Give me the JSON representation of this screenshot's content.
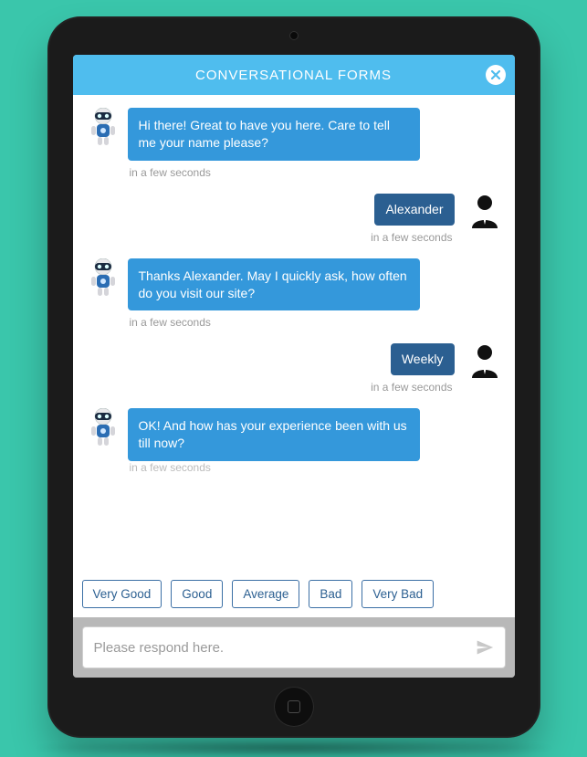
{
  "header": {
    "title": "CONVERSATIONAL FORMS"
  },
  "conversation": [
    {
      "sender": "bot",
      "text": "Hi there! Great to have you here. Care to tell me your name please?",
      "time": "in a few seconds"
    },
    {
      "sender": "user",
      "text": "Alexander",
      "time": "in a few seconds"
    },
    {
      "sender": "bot",
      "text": "Thanks Alexander. May I quickly ask, how often do you visit our site?",
      "time": "in a few seconds"
    },
    {
      "sender": "user",
      "text": "Weekly",
      "time": "in a few seconds"
    },
    {
      "sender": "bot",
      "text": "OK! And how has your experience been with us till now?",
      "time": "in a few seconds"
    }
  ],
  "options": [
    "Very Good",
    "Good",
    "Average",
    "Bad",
    "Very Bad"
  ],
  "input": {
    "placeholder": "Please respond here."
  }
}
